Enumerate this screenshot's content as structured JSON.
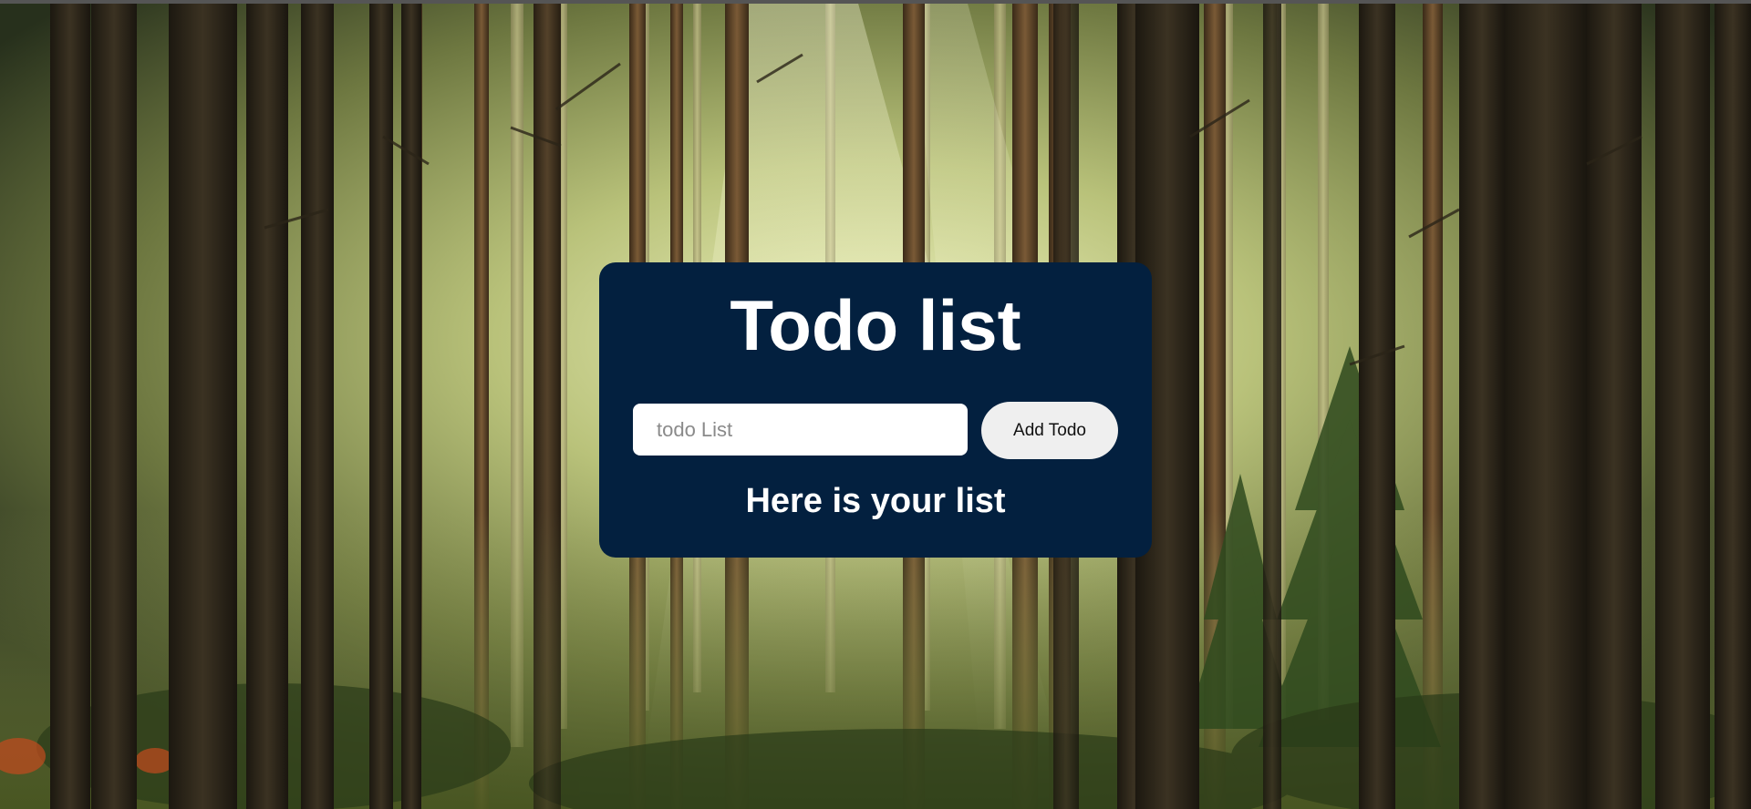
{
  "background": {
    "description_icon": "forest-background-image",
    "colors": {
      "light_center": "#e8ecb0",
      "mid_green": "#8e9a55",
      "dark_edge": "#27301c",
      "trunk_dark": "#2a2418",
      "trunk_brown": "#5a4228"
    }
  },
  "card": {
    "background_color": "#03203f",
    "title": "Todo list",
    "input": {
      "value": "",
      "placeholder": "todo List"
    },
    "add_button_label": "Add Todo",
    "list_heading": "Here is your list"
  }
}
